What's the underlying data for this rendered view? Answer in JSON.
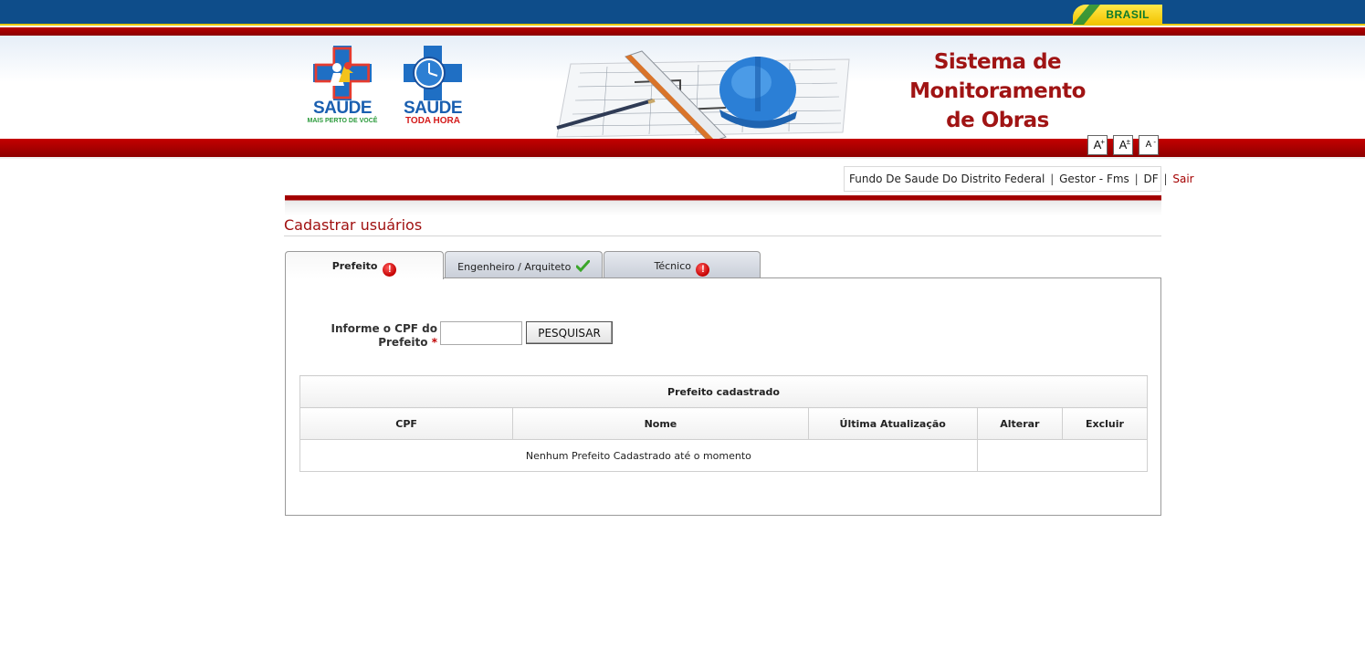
{
  "gov_bar": {
    "brand": "BRASIL"
  },
  "logos": {
    "saude_mais": {
      "word": "SAÚDE",
      "tagline": "MAIS PERTO DE VOCÊ"
    },
    "saude_hora": {
      "word": "SAÚDE",
      "tagline": "TODA HORA"
    }
  },
  "header": {
    "system_title_lines": [
      "Sistema de",
      "Monitoramento",
      "de Obras"
    ]
  },
  "font_controls": [
    {
      "label": "A",
      "sup": "+"
    },
    {
      "label": "A",
      "sup": "±"
    },
    {
      "label": "A",
      "sup": "-"
    }
  ],
  "user_bar": {
    "entity": "Fundo De Saude Do Distrito Federal",
    "role": "Gestor - Fms",
    "uf": "DF",
    "logout": "Sair",
    "separator": "|"
  },
  "page": {
    "title": "Cadastrar usuários"
  },
  "tabs": [
    {
      "label": "Prefeito",
      "status": "warning",
      "active": true
    },
    {
      "label": "Engenheiro / Arquiteto",
      "status": "ok",
      "active": false
    },
    {
      "label": "Técnico",
      "status": "warning",
      "active": false
    }
  ],
  "form": {
    "cpf_label_line1": "Informe o CPF do",
    "cpf_label_line2": "Prefeito",
    "required_mark": "*",
    "cpf_value": "",
    "search_button": "PESQUISAR"
  },
  "table": {
    "caption": "Prefeito cadastrado",
    "columns": [
      "CPF",
      "Nome",
      "Última Atualização",
      "Alterar",
      "Excluir"
    ],
    "empty_message": "Nenhum Prefeito Cadastrado até o momento"
  },
  "colors": {
    "gov_blue": "#0e4d8a",
    "brand_red": "#a01414",
    "warning_red": "#c40000",
    "ok_green": "#3aa62a"
  }
}
